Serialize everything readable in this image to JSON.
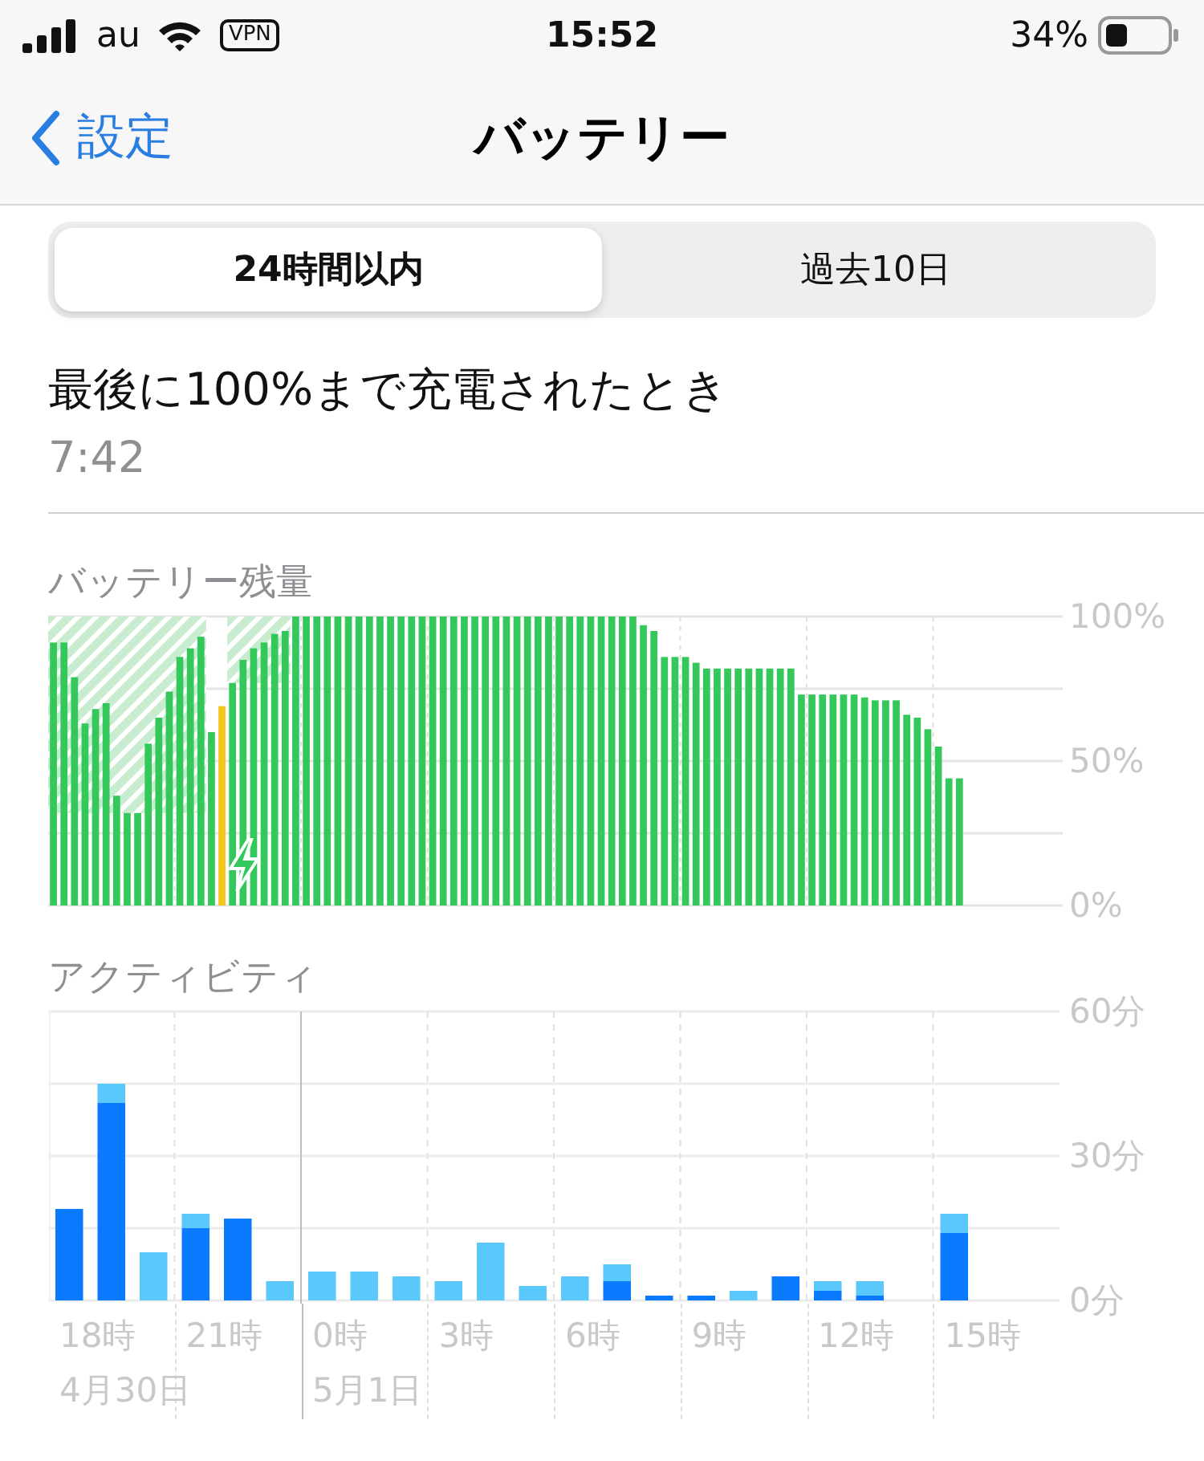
{
  "status_bar": {
    "carrier": "au",
    "vpn": "VPN",
    "time": "15:52",
    "battery_percent": "34%"
  },
  "nav": {
    "back": "設定",
    "title": "バッテリー"
  },
  "tabs": [
    {
      "label": "24時間以内",
      "selected": true
    },
    {
      "label": "過去10日",
      "selected": false
    }
  ],
  "last_charge": {
    "label": "最後に100%まで充電されたとき",
    "time": "7:42"
  },
  "battery_level": {
    "title": "バッテリー残量",
    "chart_data": {
      "type": "bar",
      "ylim": [
        0,
        100
      ],
      "yticks": [
        {
          "value": 100,
          "label": "100%"
        },
        {
          "value": 50,
          "label": "50%"
        },
        {
          "value": 0,
          "label": "0%"
        }
      ],
      "series": [
        {
          "color": "#34c759",
          "values": [
            91,
            91,
            79,
            63,
            68,
            70,
            38,
            32,
            32,
            56,
            65,
            74,
            86,
            89,
            93,
            60,
            null,
            77,
            85,
            89,
            91,
            94,
            95,
            100,
            100,
            100,
            100,
            100,
            100,
            100,
            100,
            100,
            100,
            100,
            100,
            100,
            100,
            100,
            100,
            100,
            100,
            100,
            100,
            100,
            100,
            100,
            100,
            100,
            100,
            100,
            100,
            100,
            100,
            100,
            100,
            100,
            97,
            95,
            86,
            86,
            86,
            84,
            82,
            82,
            82,
            82,
            82,
            82,
            82,
            82,
            82,
            73,
            73,
            73,
            73,
            73,
            73,
            72,
            71,
            71,
            71,
            66,
            65,
            61,
            55,
            44,
            44,
            null,
            null,
            null,
            null,
            null,
            null,
            null,
            null,
            null
          ]
        },
        {
          "color": "#f5c518",
          "values": [
            null,
            null,
            null,
            null,
            null,
            null,
            null,
            null,
            null,
            null,
            null,
            null,
            null,
            null,
            null,
            null,
            69,
            null,
            null,
            null,
            null,
            null,
            null,
            null,
            null,
            null,
            null,
            null,
            null,
            null,
            null,
            null,
            null,
            null,
            null,
            null,
            null,
            null,
            null,
            null,
            null,
            null,
            null,
            null,
            null,
            null,
            null,
            null,
            null,
            null,
            null,
            null,
            null,
            null,
            null,
            null,
            null,
            null,
            null,
            null,
            null,
            null,
            null,
            null,
            null,
            null,
            null,
            null,
            null,
            null,
            null,
            null,
            null,
            null,
            null,
            null,
            null,
            null,
            null,
            null,
            null,
            null,
            null,
            null,
            null,
            null,
            null,
            null,
            null,
            null,
            null,
            null,
            null,
            null,
            null,
            null
          ]
        }
      ]
    }
  },
  "activity": {
    "title": "アクティビティ",
    "chart_data": {
      "type": "bar",
      "ylim": [
        0,
        60
      ],
      "yticks": [
        {
          "value": 60,
          "label": "60分"
        },
        {
          "value": 30,
          "label": "30分"
        },
        {
          "value": 0,
          "label": "0分"
        }
      ],
      "stacked": true,
      "series": [
        {
          "color": "#0a7aff",
          "values": [
            19,
            41,
            null,
            15,
            17,
            null,
            null,
            null,
            null,
            null,
            null,
            null,
            null,
            4,
            1,
            1,
            null,
            5,
            2,
            1,
            null,
            14,
            null,
            null
          ]
        },
        {
          "color": "#5ac8fa",
          "values": [
            null,
            4,
            10,
            3,
            null,
            4,
            6,
            6,
            5,
            4,
            12,
            3,
            5,
            3.5,
            null,
            null,
            2,
            null,
            2,
            3,
            null,
            4,
            null,
            null
          ]
        }
      ]
    },
    "hour_labels": [
      {
        "label": "18時",
        "date": "4月30日"
      },
      {
        "label": "21時"
      },
      {
        "label": "0時",
        "date": "5月1日"
      },
      {
        "label": "3時"
      },
      {
        "label": "6時"
      },
      {
        "label": "9時"
      },
      {
        "label": "12時"
      },
      {
        "label": "15時"
      }
    ]
  }
}
